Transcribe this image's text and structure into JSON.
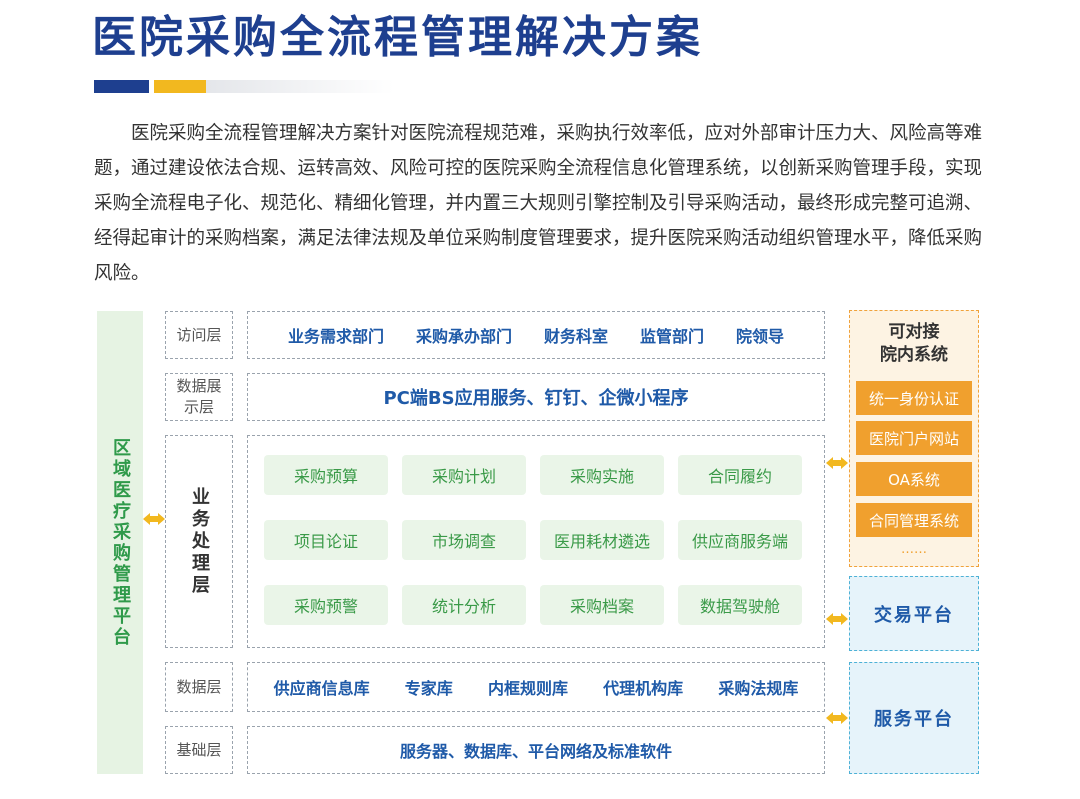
{
  "title": "医院采购全流程管理解决方案",
  "intro": "医院采购全流程管理解决方案针对医院流程规范难，采购执行效率低，应对外部审计压力大、风险高等难题，通过建设依法合规、运转高效、风险可控的医院采购全流程信息化管理系统，以创新采购管理手段，实现采购全流程电子化、规范化、精细化管理，并内置三大规则引擎控制及引导采购活动，最终形成完整可追溯、经得起审计的采购档案，满足法律法规及单位采购制度管理要求，提升医院采购活动组织管理水平，降低采购风险。",
  "left_platform": "区域医疗采购管理平台",
  "layers": {
    "access": {
      "label": "访问层",
      "items": [
        "业务需求部门",
        "采购承办部门",
        "财务科室",
        "监管部门",
        "院领导"
      ]
    },
    "display": {
      "label": "数据展示层",
      "content": "PC端BS应用服务、钉钉、企微小程序"
    },
    "business": {
      "label": "业务处理层",
      "items": [
        "采购预算",
        "采购计划",
        "采购实施",
        "合同履约",
        "项目论证",
        "市场调查",
        "医用耗材遴选",
        "供应商服务端",
        "采购预警",
        "统计分析",
        "采购档案",
        "数据驾驶舱"
      ]
    },
    "data": {
      "label": "数据层",
      "items": [
        "供应商信息库",
        "专家库",
        "内框规则库",
        "代理机构库",
        "采购法规库"
      ]
    },
    "base": {
      "label": "基础层",
      "content": "服务器、数据库、平台网络及标准软件"
    }
  },
  "right": {
    "internal_title": "可对接\n院内系统",
    "internal_systems": [
      "统一身份认证",
      "医院门户网站",
      "OA系统",
      "合同管理系统"
    ],
    "ellipsis": "……",
    "trade_platform": "交易平台",
    "service_platform": "服务平台"
  },
  "colors": {
    "title": "#1e3f8f",
    "accent_yellow": "#f2b81f",
    "green": "#2f9a4a",
    "blue_text": "#1f5aa8",
    "orange": "#f0a02e"
  }
}
